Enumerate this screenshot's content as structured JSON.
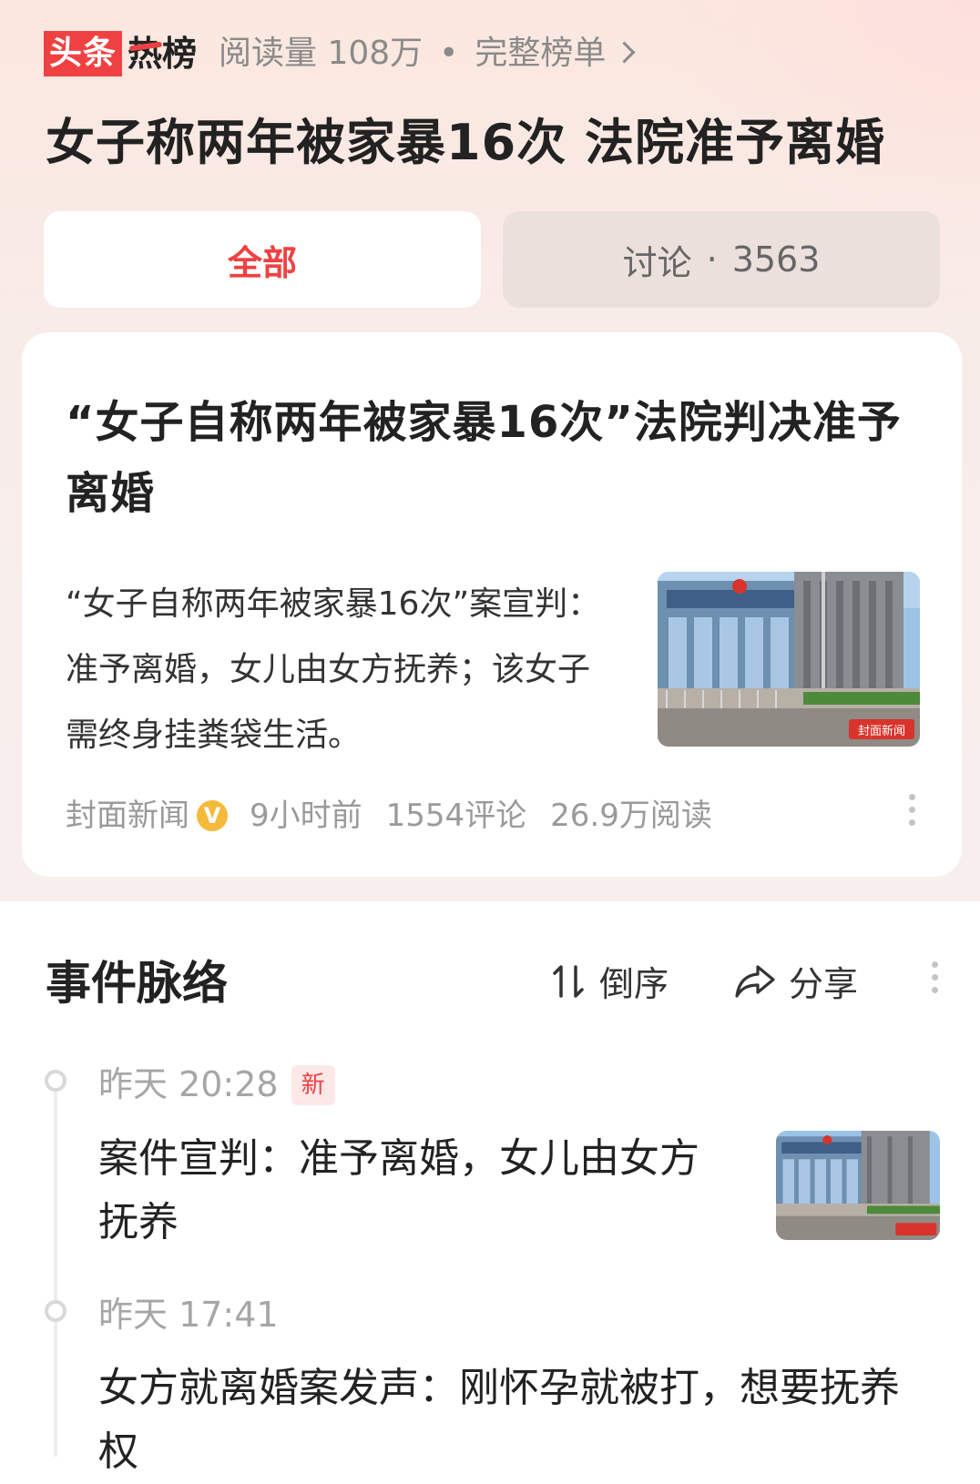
{
  "header": {
    "logo_part1": "头条",
    "logo_part2": "热榜",
    "reads_label": "阅读量 108万",
    "separator": "•",
    "full_list_label": "完整榜单"
  },
  "headline": "女子称两年被家暴16次 法院准予离婚",
  "tabs": {
    "all": "全部",
    "discuss_label": "讨论",
    "discuss_sep": "·",
    "discuss_count": "3563"
  },
  "article": {
    "title": "“女子自称两年被家暴16次”法院判决准予离婚",
    "summary": "“女子自称两年被家暴16次”案宣判：准予离婚，女儿由女方抚养；该女子需终身挂粪袋生活。",
    "source": "封面新闻",
    "verified_icon": "V",
    "time": "9小时前",
    "comments": "1554评论",
    "reads": "26.9万阅读",
    "image_watermark": "封面新闻"
  },
  "timeline": {
    "title": "事件脉络",
    "order_label": "倒序",
    "share_label": "分享",
    "items": [
      {
        "time": "昨天 20:28",
        "badge": "新",
        "text": "案件宣判：准予离婚，女儿由女方抚养"
      },
      {
        "time": "昨天 17:41",
        "text": "女方就离婚案发声：刚怀孕就被打，想要抚养权"
      }
    ]
  },
  "colors": {
    "accent": "#f04142",
    "verified": "#f5b93b"
  }
}
